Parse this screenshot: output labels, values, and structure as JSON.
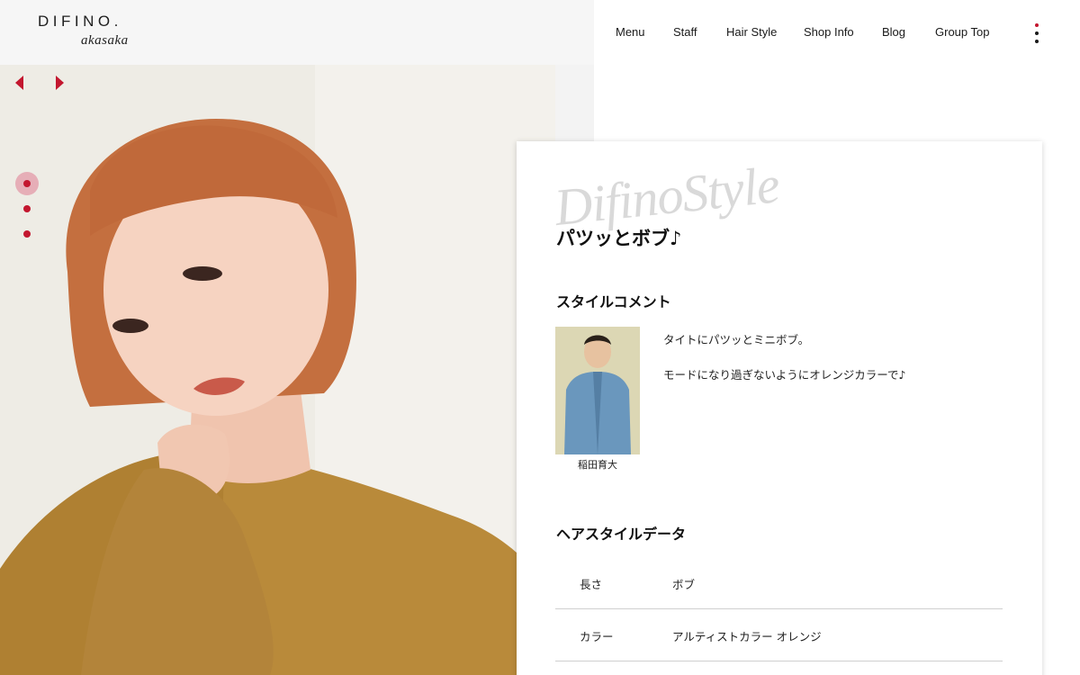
{
  "header": {
    "logo_main": "DIFINO.",
    "logo_sub": "akasaka",
    "nav": [
      {
        "label": "Menu"
      },
      {
        "label": "Staff"
      },
      {
        "label": "Hair Style"
      },
      {
        "label": "Shop Info"
      },
      {
        "label": "Blog"
      },
      {
        "label": "Group Top"
      }
    ],
    "more_icon": "kebab-menu-icon"
  },
  "slider": {
    "prev_icon": "arrow-left-icon",
    "next_icon": "arrow-right-icon",
    "dots": 3,
    "active_dot": 1
  },
  "card": {
    "watermark": "DifinoStyle",
    "title": "パツッとボブ♪",
    "comment_heading": "スタイルコメント",
    "staff_name": "稲田育大",
    "comments": [
      "タイトにパツッとミニボブ。",
      "モードになり過ぎないようにオレンジカラーで♪"
    ],
    "data_heading": "ヘアスタイルデータ",
    "data": [
      {
        "key": "長さ",
        "value": "ボブ"
      },
      {
        "key": "カラー",
        "value": "アルティストカラー オレンジ"
      }
    ]
  },
  "colors": {
    "accent": "#c3172f",
    "accent_light": "#e6aeb7",
    "header_bg": "#f6f6f6",
    "watermark": "#d9d9d9"
  }
}
